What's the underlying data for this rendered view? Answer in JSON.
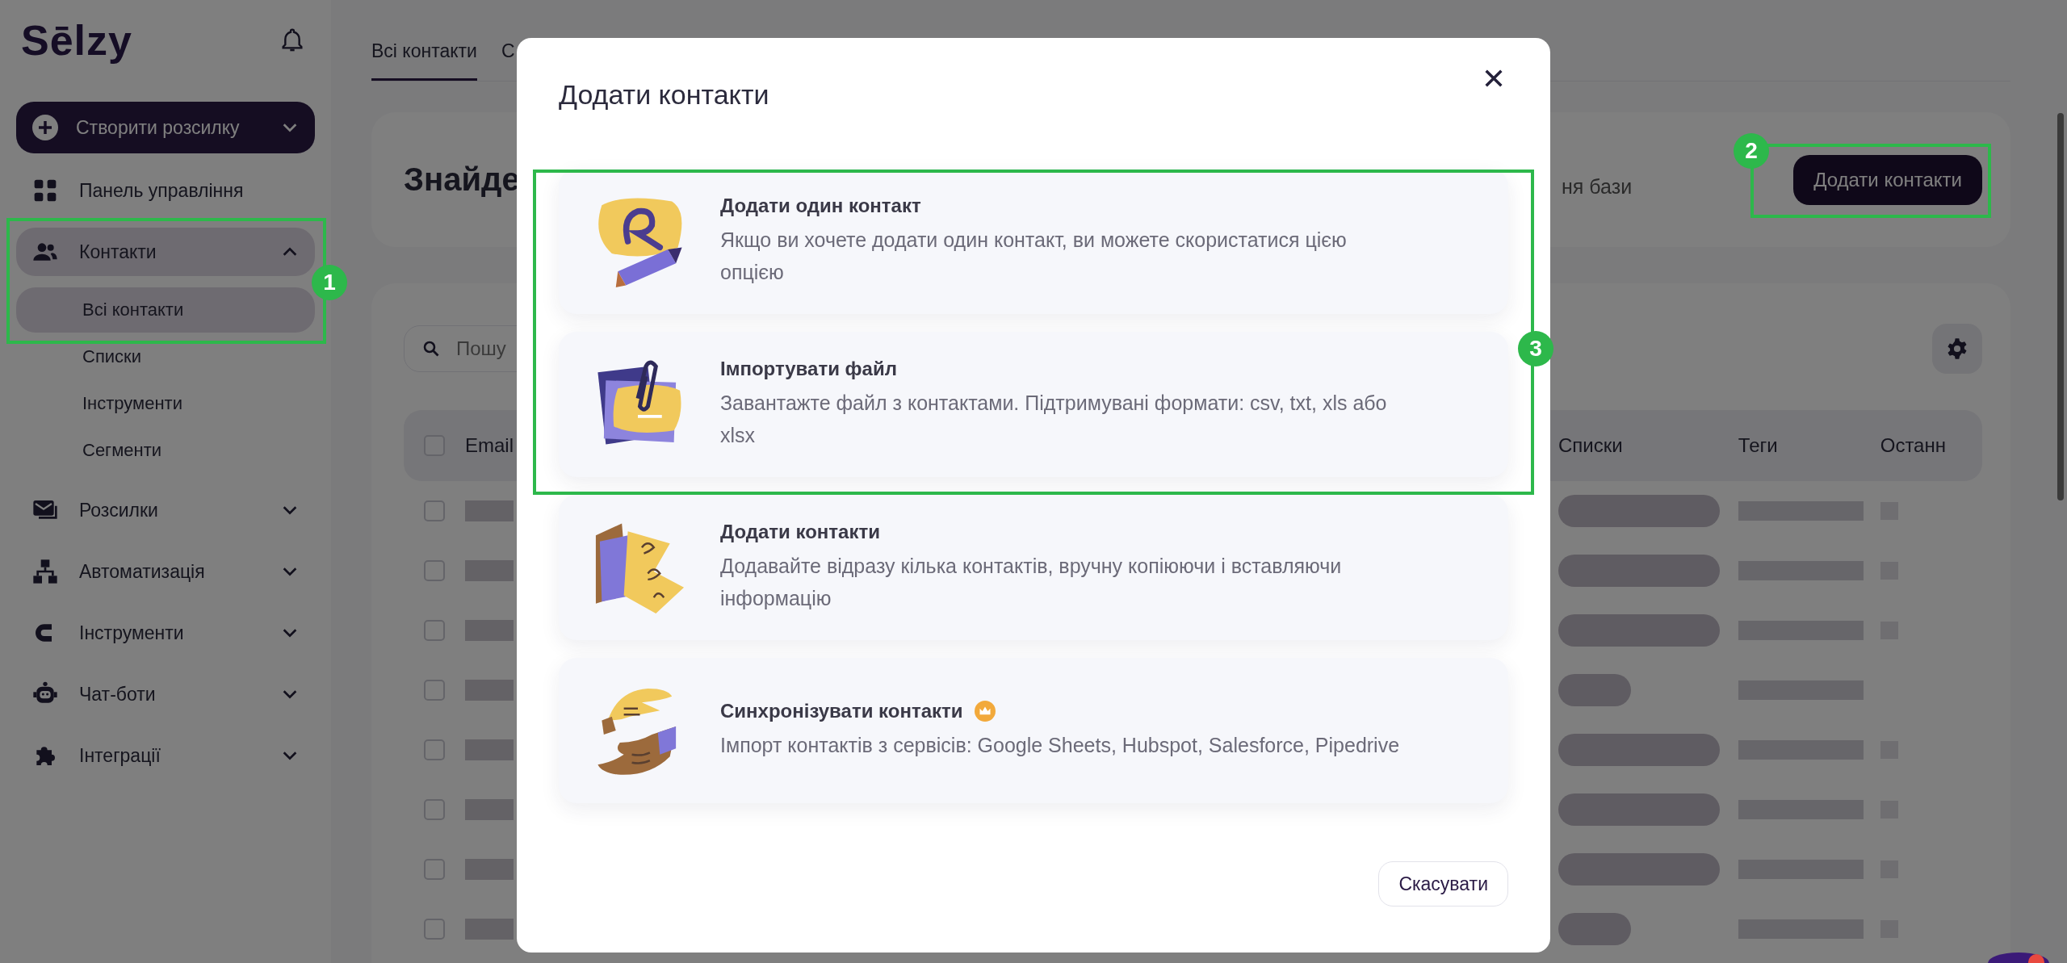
{
  "sidebar": {
    "logo": "Sēlzy",
    "create_button": {
      "label": "Створити розсилку"
    },
    "items": [
      {
        "label": "Панель управління",
        "selected": false
      },
      {
        "label": "Контакти",
        "selected": true,
        "expanded": true,
        "children": [
          {
            "label": "Всі контакти",
            "selected": true
          },
          {
            "label": "Списки",
            "selected": false
          },
          {
            "label": "Інструменти",
            "selected": false
          },
          {
            "label": "Сегменти",
            "selected": false
          }
        ]
      },
      {
        "label": "Розсилки",
        "selected": false,
        "expanded": false
      },
      {
        "label": "Автоматизація",
        "selected": false,
        "expanded": false
      },
      {
        "label": "Інструменти",
        "selected": false,
        "expanded": false
      },
      {
        "label": "Чат-боти",
        "selected": false,
        "expanded": false
      },
      {
        "label": "Інтеграції",
        "selected": false,
        "expanded": false
      }
    ]
  },
  "tabs": [
    {
      "label": "Всі контакти",
      "selected": true
    },
    {
      "label": "С",
      "selected": false
    }
  ],
  "header": {
    "title": "Знайде",
    "note": "ня бази",
    "add_button": "Додати контакти"
  },
  "table": {
    "search_placeholder": "Пошу",
    "header_checked": false,
    "columns": [
      "Email",
      "Списки",
      "Теги",
      "Останн"
    ],
    "rows": [
      {
        "checked": false
      },
      {
        "checked": false
      },
      {
        "checked": false
      },
      {
        "checked": false
      },
      {
        "checked": false
      },
      {
        "checked": false
      },
      {
        "checked": false
      },
      {
        "checked": false
      }
    ]
  },
  "modal": {
    "title": "Додати контакти",
    "options": [
      {
        "title": "Додати один контакт",
        "description": "Якщо ви хочете додати один контакт, ви можете скористатися цією опцією",
        "premium": false
      },
      {
        "title": "Імпортувати файл",
        "description": "Завантажте файл з контактами. Підтримувані формати: csv, txt, xls або xlsx",
        "premium": false
      },
      {
        "title": "Додати контакти",
        "description": "Додавайте відразу кілька контактів, вручну копіюючи і вставляючи інформацію",
        "premium": false
      },
      {
        "title": "Синхронізувати контакти",
        "description": "Імпорт контактів з сервісів: Google Sheets, Hubspot, Salesforce, Pipedrive",
        "premium": true
      }
    ],
    "cancel_button": "Скасувати"
  },
  "annotations": [
    {
      "label": "1"
    },
    {
      "label": "2"
    },
    {
      "label": "3"
    }
  ]
}
